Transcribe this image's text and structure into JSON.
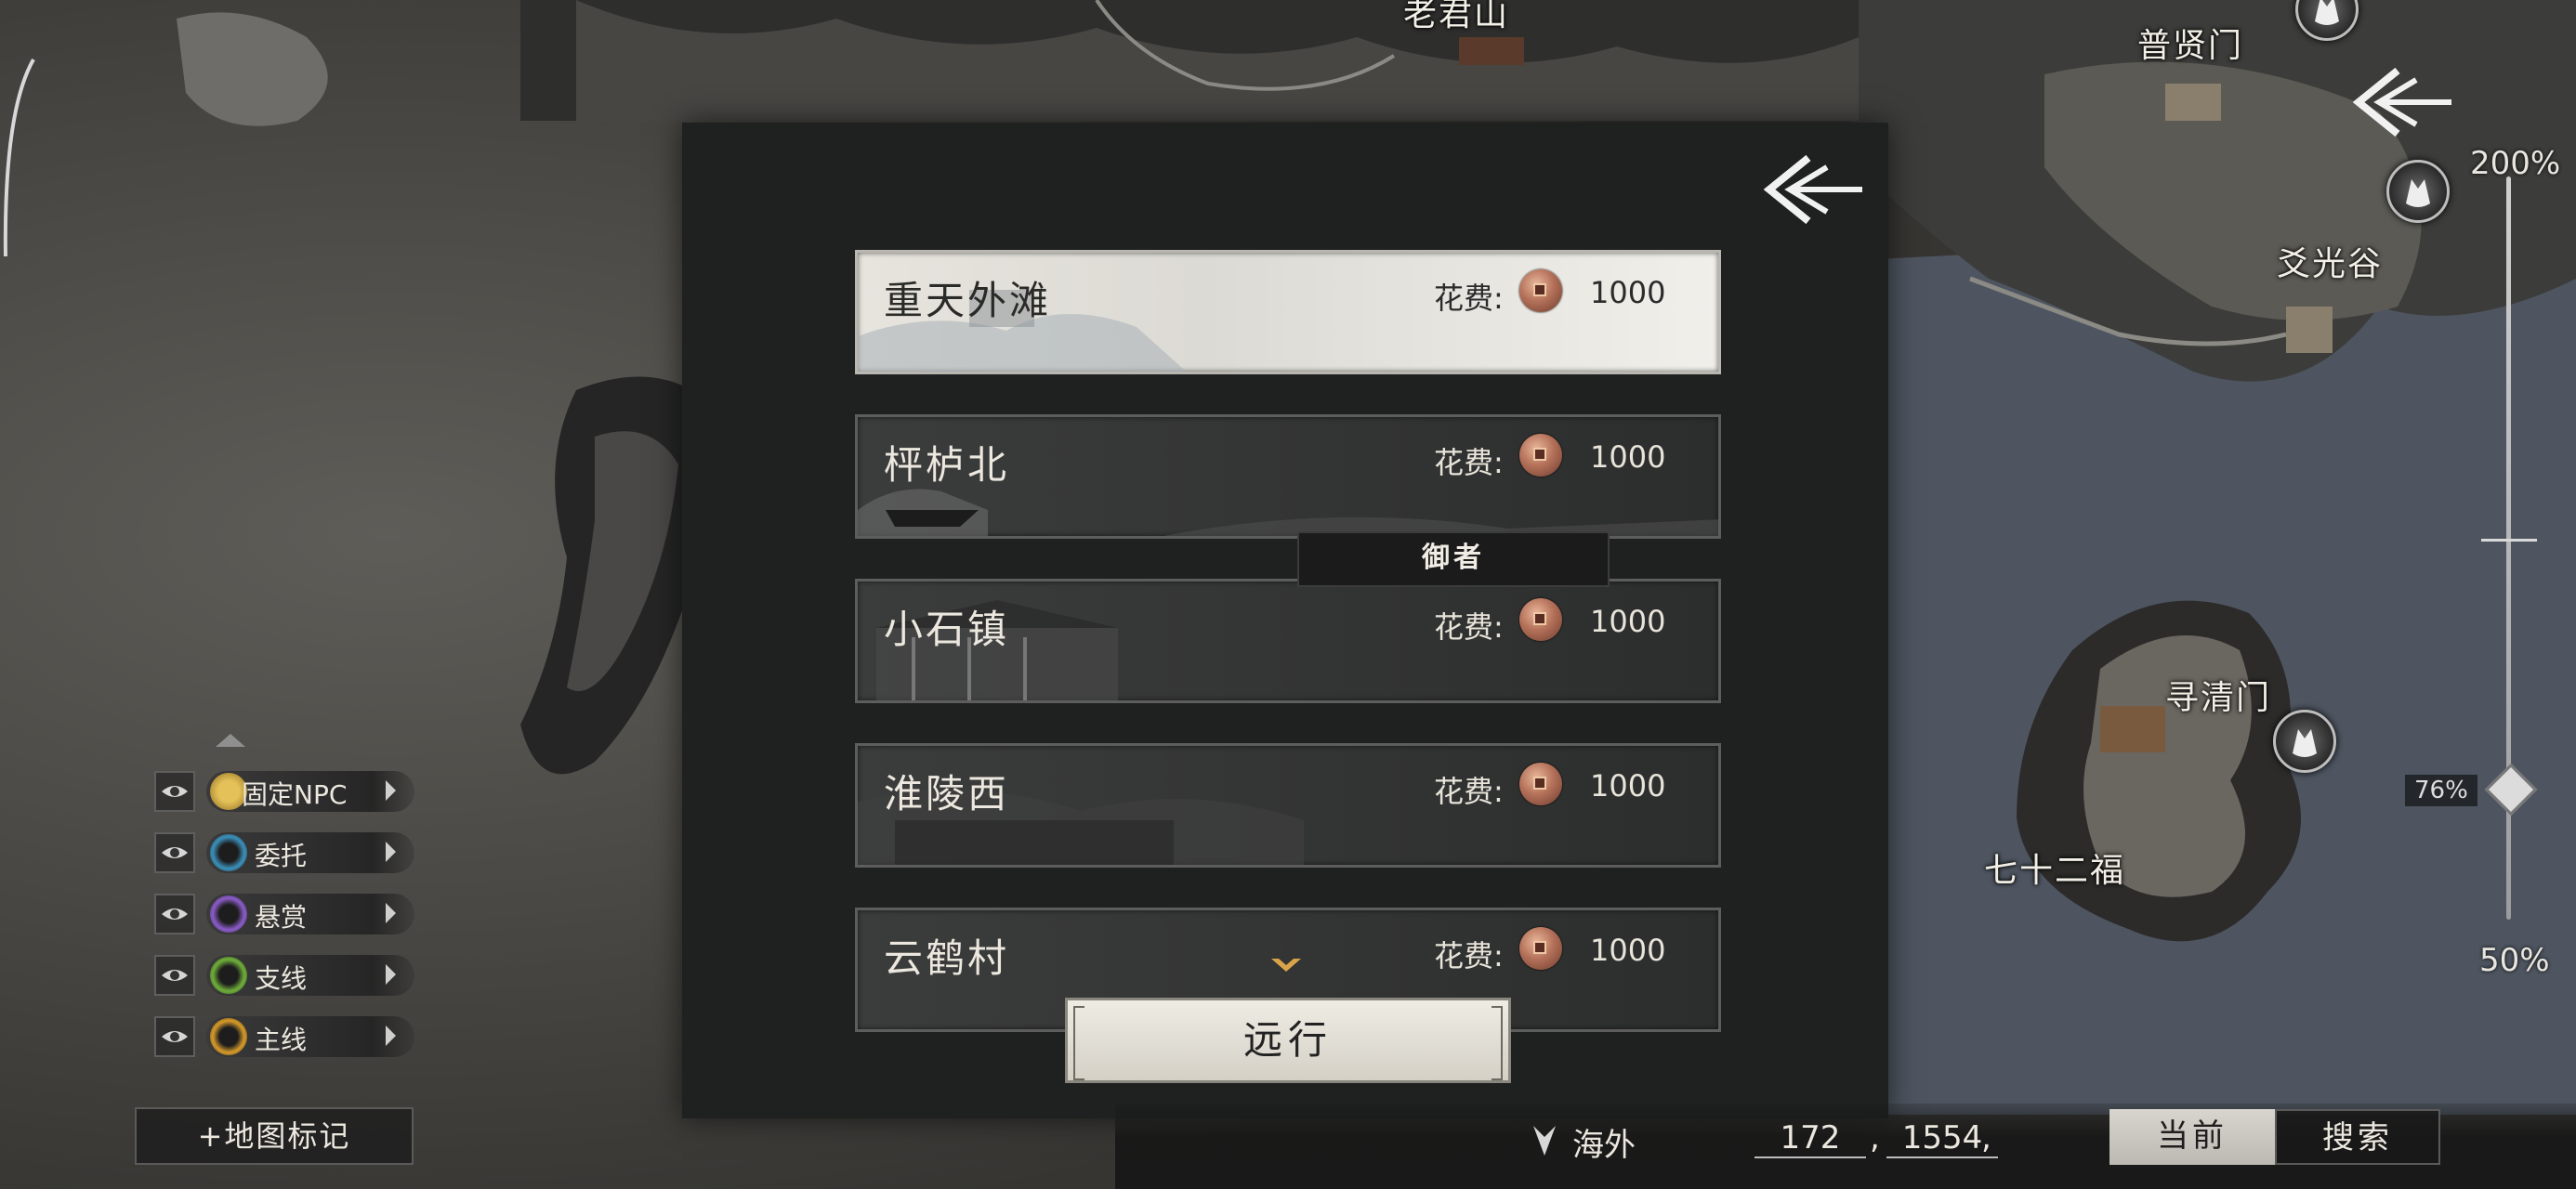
{
  "map_labels": {
    "top_center": "老君山",
    "top_right": "普贤门",
    "right_valley": "爻光谷",
    "sect": "寻清门",
    "fort": "七十二福"
  },
  "zoom": {
    "max_label": "200%",
    "min_label": "50%",
    "current_label": "76%",
    "current_fraction": 0.76
  },
  "dialog": {
    "destinations": [
      {
        "name": "重天外滩",
        "cost_label": "花费:",
        "cost": "1000",
        "selected": true
      },
      {
        "name": "枰栌北",
        "cost_label": "花费:",
        "cost": "1000",
        "selected": false
      },
      {
        "name": "小石镇",
        "cost_label": "花费:",
        "cost": "1000",
        "selected": false
      },
      {
        "name": "淮陵西",
        "cost_label": "花费:",
        "cost": "1000",
        "selected": false
      },
      {
        "name": "云鹤村",
        "cost_label": "花费:",
        "cost": "1000",
        "selected": false
      }
    ],
    "driver_label": "御者",
    "travel_button": "远行"
  },
  "filters": [
    {
      "label": "固定NPC",
      "color": "#c9a23a"
    },
    {
      "label": "委托",
      "color": "#3b8fb8"
    },
    {
      "label": "悬赏",
      "color": "#8a5cc7"
    },
    {
      "label": "支线",
      "color": "#6fae3a"
    },
    {
      "label": "主线",
      "color": "#d49a2a"
    }
  ],
  "add_marker_button": "+地图标记",
  "bottom_bar": {
    "region": "海外",
    "coord_x": "172",
    "coord_y": "1554",
    "separator": ",",
    "tab_current": "当前",
    "tab_search": "搜索"
  }
}
